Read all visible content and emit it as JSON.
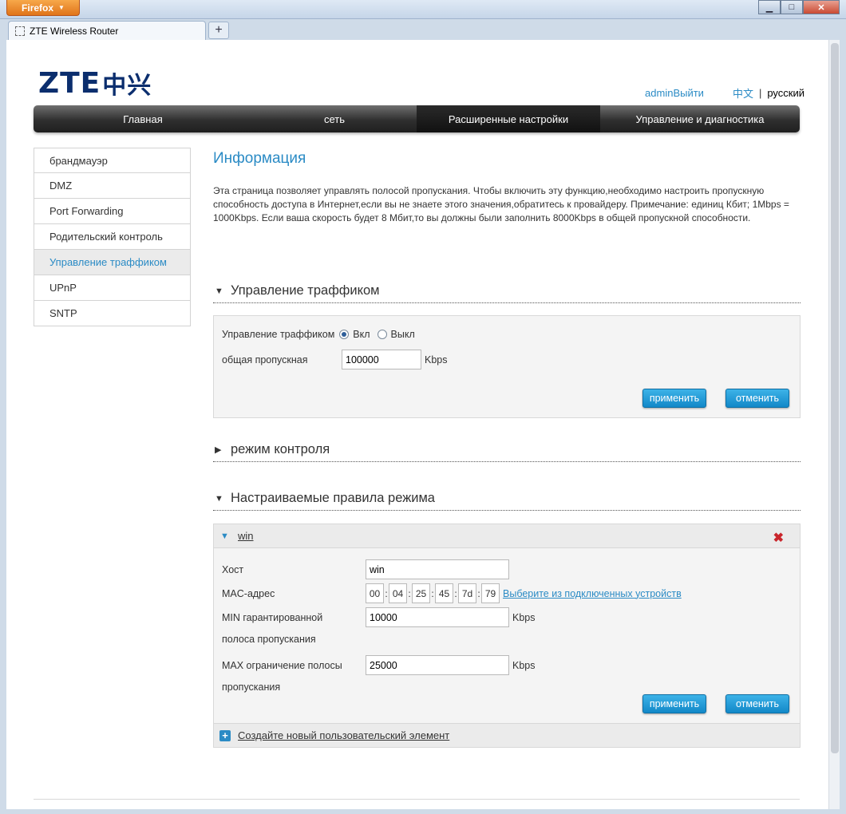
{
  "browser": {
    "menu_label": "Firefox",
    "tab_title": "ZTE Wireless Router",
    "new_tab_label": "+"
  },
  "header": {
    "logo_latin": "ZTE",
    "logo_chinese": "中兴",
    "admin_link": "adminВыйти",
    "lang_zh": "中文",
    "lang_sep": "|",
    "lang_ru": "русский"
  },
  "nav": {
    "items": [
      {
        "label": "Главная",
        "active": false
      },
      {
        "label": "сеть",
        "active": false
      },
      {
        "label": "Расширенные настройки",
        "active": true
      },
      {
        "label": "Управление и диагностика",
        "active": false
      }
    ]
  },
  "sidebar": {
    "items": [
      {
        "label": "брандмауэр",
        "active": false
      },
      {
        "label": "DMZ",
        "active": false
      },
      {
        "label": "Port Forwarding",
        "active": false
      },
      {
        "label": "Родительский контроль",
        "active": false
      },
      {
        "label": "Управление траффиком",
        "active": true
      },
      {
        "label": "UPnP",
        "active": false
      },
      {
        "label": "SNTP",
        "active": false
      }
    ]
  },
  "info": {
    "title": "Информация",
    "text": "Эта страница позволяет управлять полосой пропускания. Чтобы включить эту функцию,необходимо настроить пропускную способность доступа в Интернет,если вы не знаете этого значения,обратитесь к провайдеру. Примечание: единиц Кбит; 1Mbps = 1000Kbps. Если ваша скорость будет 8 Мбит,то вы должны были заполнить 8000Kbps в общей пропускной способности."
  },
  "traffic_section": {
    "title": "Управление траффиком",
    "control_label": "Управление траффиком",
    "on_label": "Вкл",
    "off_label": "Выкл",
    "selected": "on",
    "bandwidth_label": "общая пропускная",
    "bandwidth_value": "100000",
    "unit": "Kbps",
    "apply_label": "применить",
    "cancel_label": "отменить"
  },
  "control_mode_section": {
    "title": "режим контроля"
  },
  "custom_rules_section": {
    "title": "Настраиваемые правила режима",
    "rule": {
      "name": "win",
      "host_label": "Хост",
      "host_value": "win",
      "mac_label": "MAC-адрес",
      "mac_octets": [
        "00",
        "04",
        "25",
        "45",
        "7d",
        "79"
      ],
      "mac_select_link": "Выберите из подключенных устройств",
      "min_label_line1": "MIN гарантированной",
      "min_label_line2": "полоса пропускания",
      "min_value": "10000",
      "max_label_line1": "MAX ограничение полосы",
      "max_label_line2": "пропускания",
      "max_value": "25000",
      "unit": "Kbps",
      "apply_label": "применить",
      "cancel_label": "отменить"
    },
    "add_new_label": "Создайте новый пользовательский элемент"
  },
  "colors": {
    "accent": "#2b8bc5",
    "button": "#1a9ad6",
    "delete": "#c9252b",
    "nav_dark": "#2f2f2f"
  }
}
